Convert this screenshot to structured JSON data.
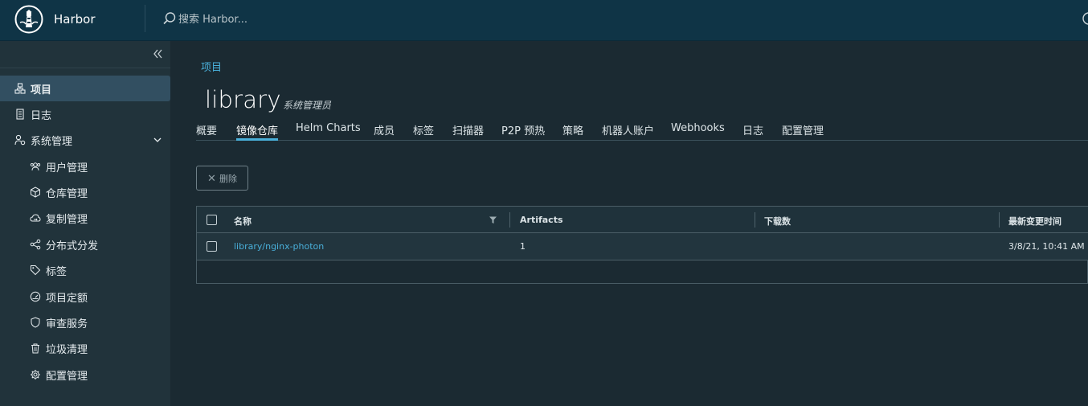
{
  "header": {
    "app_name": "Harbor",
    "search_placeholder": "搜索 Harbor..."
  },
  "sidebar": {
    "items": [
      {
        "label": "项目",
        "icon": "project-icon",
        "active": true
      },
      {
        "label": "日志",
        "icon": "log-icon"
      },
      {
        "label": "系统管理",
        "icon": "admin-icon",
        "expanded": true
      },
      {
        "label": "用户管理",
        "icon": "users-icon"
      },
      {
        "label": "仓库管理",
        "icon": "box-icon"
      },
      {
        "label": "复制管理",
        "icon": "cloud-sync-icon"
      },
      {
        "label": "分布式分发",
        "icon": "share-icon"
      },
      {
        "label": "标签",
        "icon": "tag-icon"
      },
      {
        "label": "项目定额",
        "icon": "quota-gauge-icon"
      },
      {
        "label": "审查服务",
        "icon": "shield-icon"
      },
      {
        "label": "垃圾清理",
        "icon": "trash-icon"
      },
      {
        "label": "配置管理",
        "icon": "gear-icon"
      }
    ]
  },
  "main": {
    "breadcrumb": "项目",
    "title": "library",
    "role": "系统管理员",
    "tabs": [
      "概要",
      "镜像仓库",
      "Helm Charts",
      "成员",
      "标签",
      "扫描器",
      "P2P 预热",
      "策略",
      "机器人账户",
      "Webhooks",
      "日志",
      "配置管理"
    ],
    "active_tab": "镜像仓库",
    "delete_label": "删除",
    "table": {
      "columns": [
        "名称",
        "Artifacts",
        "下载数",
        "最新变更时间"
      ],
      "rows": [
        {
          "name": "library/nginx-photon",
          "artifacts": "1",
          "downloads": "",
          "updated": "3/8/21, 10:41 AM"
        }
      ]
    }
  },
  "colors": {
    "accent": "#49afd9",
    "header_bg": "#0f3446",
    "sidebar_bg": "#21333b",
    "content_bg": "#1b2a32",
    "active_nav_bg": "#324f61"
  }
}
